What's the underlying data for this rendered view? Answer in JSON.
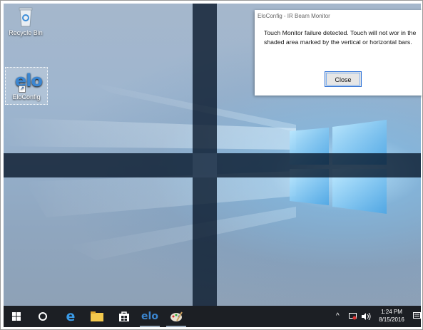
{
  "desktop": {
    "icons": [
      {
        "label": "Recycle Bin",
        "icon": "recycle-bin-icon"
      },
      {
        "label": "EloConfig",
        "icon": "elo-config-icon",
        "logo_text": "elo"
      }
    ]
  },
  "dialog": {
    "title": "EloConfig - IR Beam Monitor",
    "message": "Touch Monitor failure detected. Touch will not wor in the shaded area marked by the vertical or horizontal bars.",
    "close_label": "Close"
  },
  "taskbar": {
    "items": [
      "start-icon",
      "cortana-icon",
      "edge-icon",
      "file-explorer-icon",
      "store-icon",
      "elo-icon",
      "paint-icon"
    ],
    "elo_label": "elo",
    "time": "1:24 PM",
    "date": "8/15/2016"
  },
  "colors": {
    "beam_shade": "#05142a",
    "dialog_button_border": "#2a6fd6",
    "taskbar_bg": "#1c1f24"
  }
}
